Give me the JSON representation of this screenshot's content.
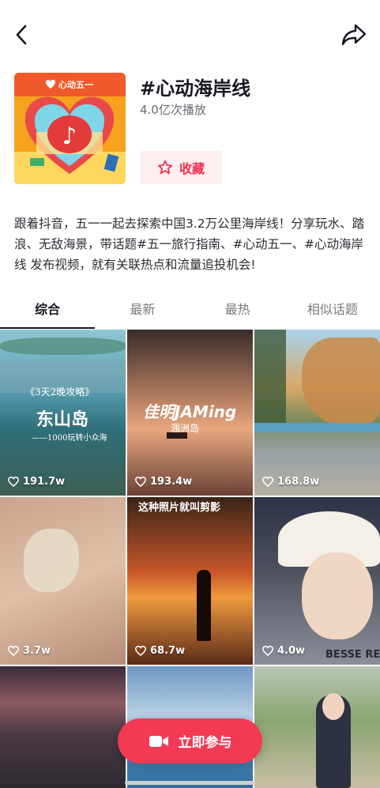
{
  "topic": {
    "title": "#心动海岸线",
    "plays": "4.0亿次播放",
    "favorite_label": "收藏",
    "cover_brand": "心动五一",
    "description": "跟着抖音，五一一起去探索中国3.2万公里海岸线！分享玩水、踏浪、无敌海景，带话题#五一旅行指南、#心动五一、#心动海岸线 发布视频，就有关联热点和流量追投机会!"
  },
  "tabs": [
    {
      "label": "综合",
      "active": true
    },
    {
      "label": "最新",
      "active": false
    },
    {
      "label": "最热",
      "active": false
    },
    {
      "label": "相似话题",
      "active": false
    }
  ],
  "videos": [
    {
      "likes": "191.7w",
      "overlay_lines": [
        "《3天2晚攻略》",
        "东山岛",
        "——1000玩转小众海"
      ]
    },
    {
      "likes": "193.4w",
      "overlay_lines": [
        "佳明JAMing",
        "涠洲岛"
      ]
    },
    {
      "likes": "168.8w",
      "overlay_lines": []
    },
    {
      "likes": "3.7w",
      "overlay_lines": []
    },
    {
      "likes": "68.7w",
      "overlay_lines": [
        "这种照片就叫剪影"
      ]
    },
    {
      "likes": "4.0w",
      "overlay_lines": [
        "BESSE REI"
      ]
    },
    {
      "likes": "",
      "overlay_lines": []
    },
    {
      "likes": "",
      "overlay_lines": []
    },
    {
      "likes": "",
      "overlay_lines": []
    }
  ],
  "join_button": {
    "label": "立即参与"
  },
  "colors": {
    "accent": "#f23a55",
    "favorite_bg": "#fdeef0",
    "text_primary": "#161823",
    "text_secondary": "#6b6b72"
  },
  "icons": [
    "back-arrow-icon",
    "share-icon",
    "star-icon",
    "heart-icon",
    "video-camera-icon"
  ]
}
